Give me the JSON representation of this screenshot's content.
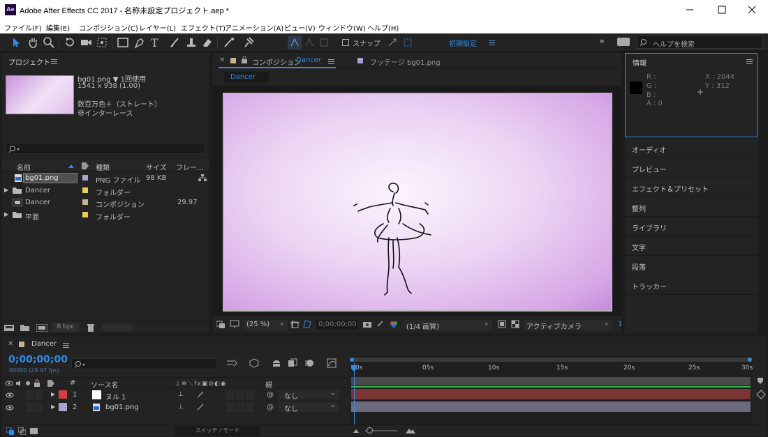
{
  "window": {
    "title": "Adobe After Effects CC 2017 - 名称未設定プロジェクト.aep *",
    "app_icon": "Ae"
  },
  "menu": [
    "ファイル(F)",
    "編集(E)",
    "コンポジション(C)",
    "レイヤー(L)",
    "エフェクト(T)",
    "アニメーション(A)",
    "ビュー(V)",
    "ウィンドウ(W)",
    "ヘルプ(H)"
  ],
  "toolbar": {
    "snap_label": "スナップ",
    "workspace": "初期設定",
    "help_placeholder": "ヘルプを検索"
  },
  "project": {
    "title": "プロジェクト",
    "selected_name": "bg01.png ▼ 1回使用",
    "dims": "1541 x 938 (1.00)",
    "color": "数百万色＋（ストレート）",
    "interlace": "非インターレース",
    "columns": [
      "名前",
      "種類",
      "サイズ",
      "フレー..."
    ],
    "items": [
      {
        "name": "bg01.png",
        "type": "PNG ファイル",
        "size": "98 KB",
        "fps": "",
        "icon": "png-file-icon",
        "color": "#a9a4cf"
      },
      {
        "name": "Dancer",
        "type": "フォルダー",
        "size": "",
        "fps": "",
        "icon": "folder-icon",
        "color": "#e8d24c"
      },
      {
        "name": "Dancer",
        "type": "コンポジション",
        "size": "",
        "fps": "29.97",
        "icon": "composition-icon",
        "color": "#c7b48b"
      },
      {
        "name": "平面",
        "type": "フォルダー",
        "size": "",
        "fps": "",
        "icon": "folder-icon",
        "color": "#e8d24c"
      }
    ],
    "bpc": "8 bpc"
  },
  "viewer": {
    "comp_tab_prefix": "コンポジション",
    "comp_tab_name": "Dancer",
    "footage_tab": "フッテージ bg01.png",
    "breadcrumb": "Dancer",
    "zoom": "(25 %)",
    "timecode": "0;00;00;00",
    "resolution": "(1/4 画質)",
    "camera": "アクティブカメラ",
    "views": "1"
  },
  "info": {
    "title": "情報",
    "r": "R :",
    "g": "G :",
    "b": "B :",
    "a": "A : 0",
    "x": "X : 2044",
    "y": "Y : 312"
  },
  "right_panels": [
    "オーディオ",
    "プレビュー",
    "エフェクト＆プリセット",
    "整列",
    "ライブラリ",
    "文字",
    "段落",
    "トラッカー"
  ],
  "timeline": {
    "tab": "Dancer",
    "timecode": "0;00;00;00",
    "fps_note": "00000 (29.97 fps)",
    "col_num": "#",
    "col_source": "ソース名",
    "col_parent": "親",
    "layers": [
      {
        "num": "1",
        "name": "ヌル 1",
        "parent": "なし",
        "label_color": "#d04040",
        "icon": "null-layer-icon",
        "bar": "#7a3535"
      },
      {
        "num": "2",
        "name": "bg01.png",
        "parent": "なし",
        "label_color": "#a9a4cf",
        "icon": "png-file-icon",
        "bar": "#6d6a7d"
      }
    ],
    "ruler": [
      "0s",
      "05s",
      "10s",
      "15s",
      "20s",
      "25s",
      "30s"
    ],
    "switch_mode": "スイッチ / モード"
  }
}
